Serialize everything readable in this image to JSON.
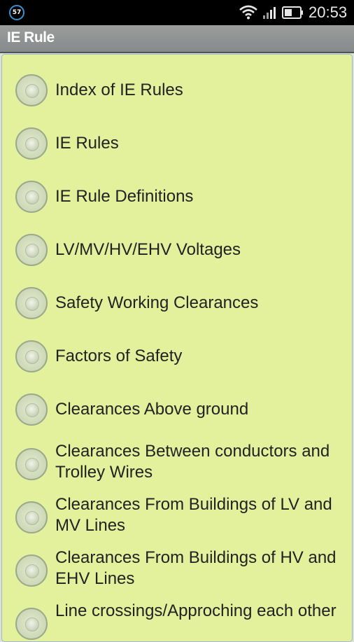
{
  "status_bar": {
    "notification_badge": "57",
    "time": "20:53"
  },
  "action_bar": {
    "title": "IE Rule"
  },
  "options": [
    {
      "label": "Index of IE Rules"
    },
    {
      "label": "IE Rules"
    },
    {
      "label": "IE Rule Definitions"
    },
    {
      "label": "LV/MV/HV/EHV Voltages"
    },
    {
      "label": "Safety Working Clearances"
    },
    {
      "label": "Factors of Safety"
    },
    {
      "label": "Clearances Above ground"
    },
    {
      "label": "Clearances Between conductors and Trolley Wires"
    },
    {
      "label": "Clearances From Buildings of LV and MV Lines"
    },
    {
      "label": "Clearances From Buildings of HV and EHV Lines"
    },
    {
      "label": "Line crossings/Approching each other"
    }
  ]
}
